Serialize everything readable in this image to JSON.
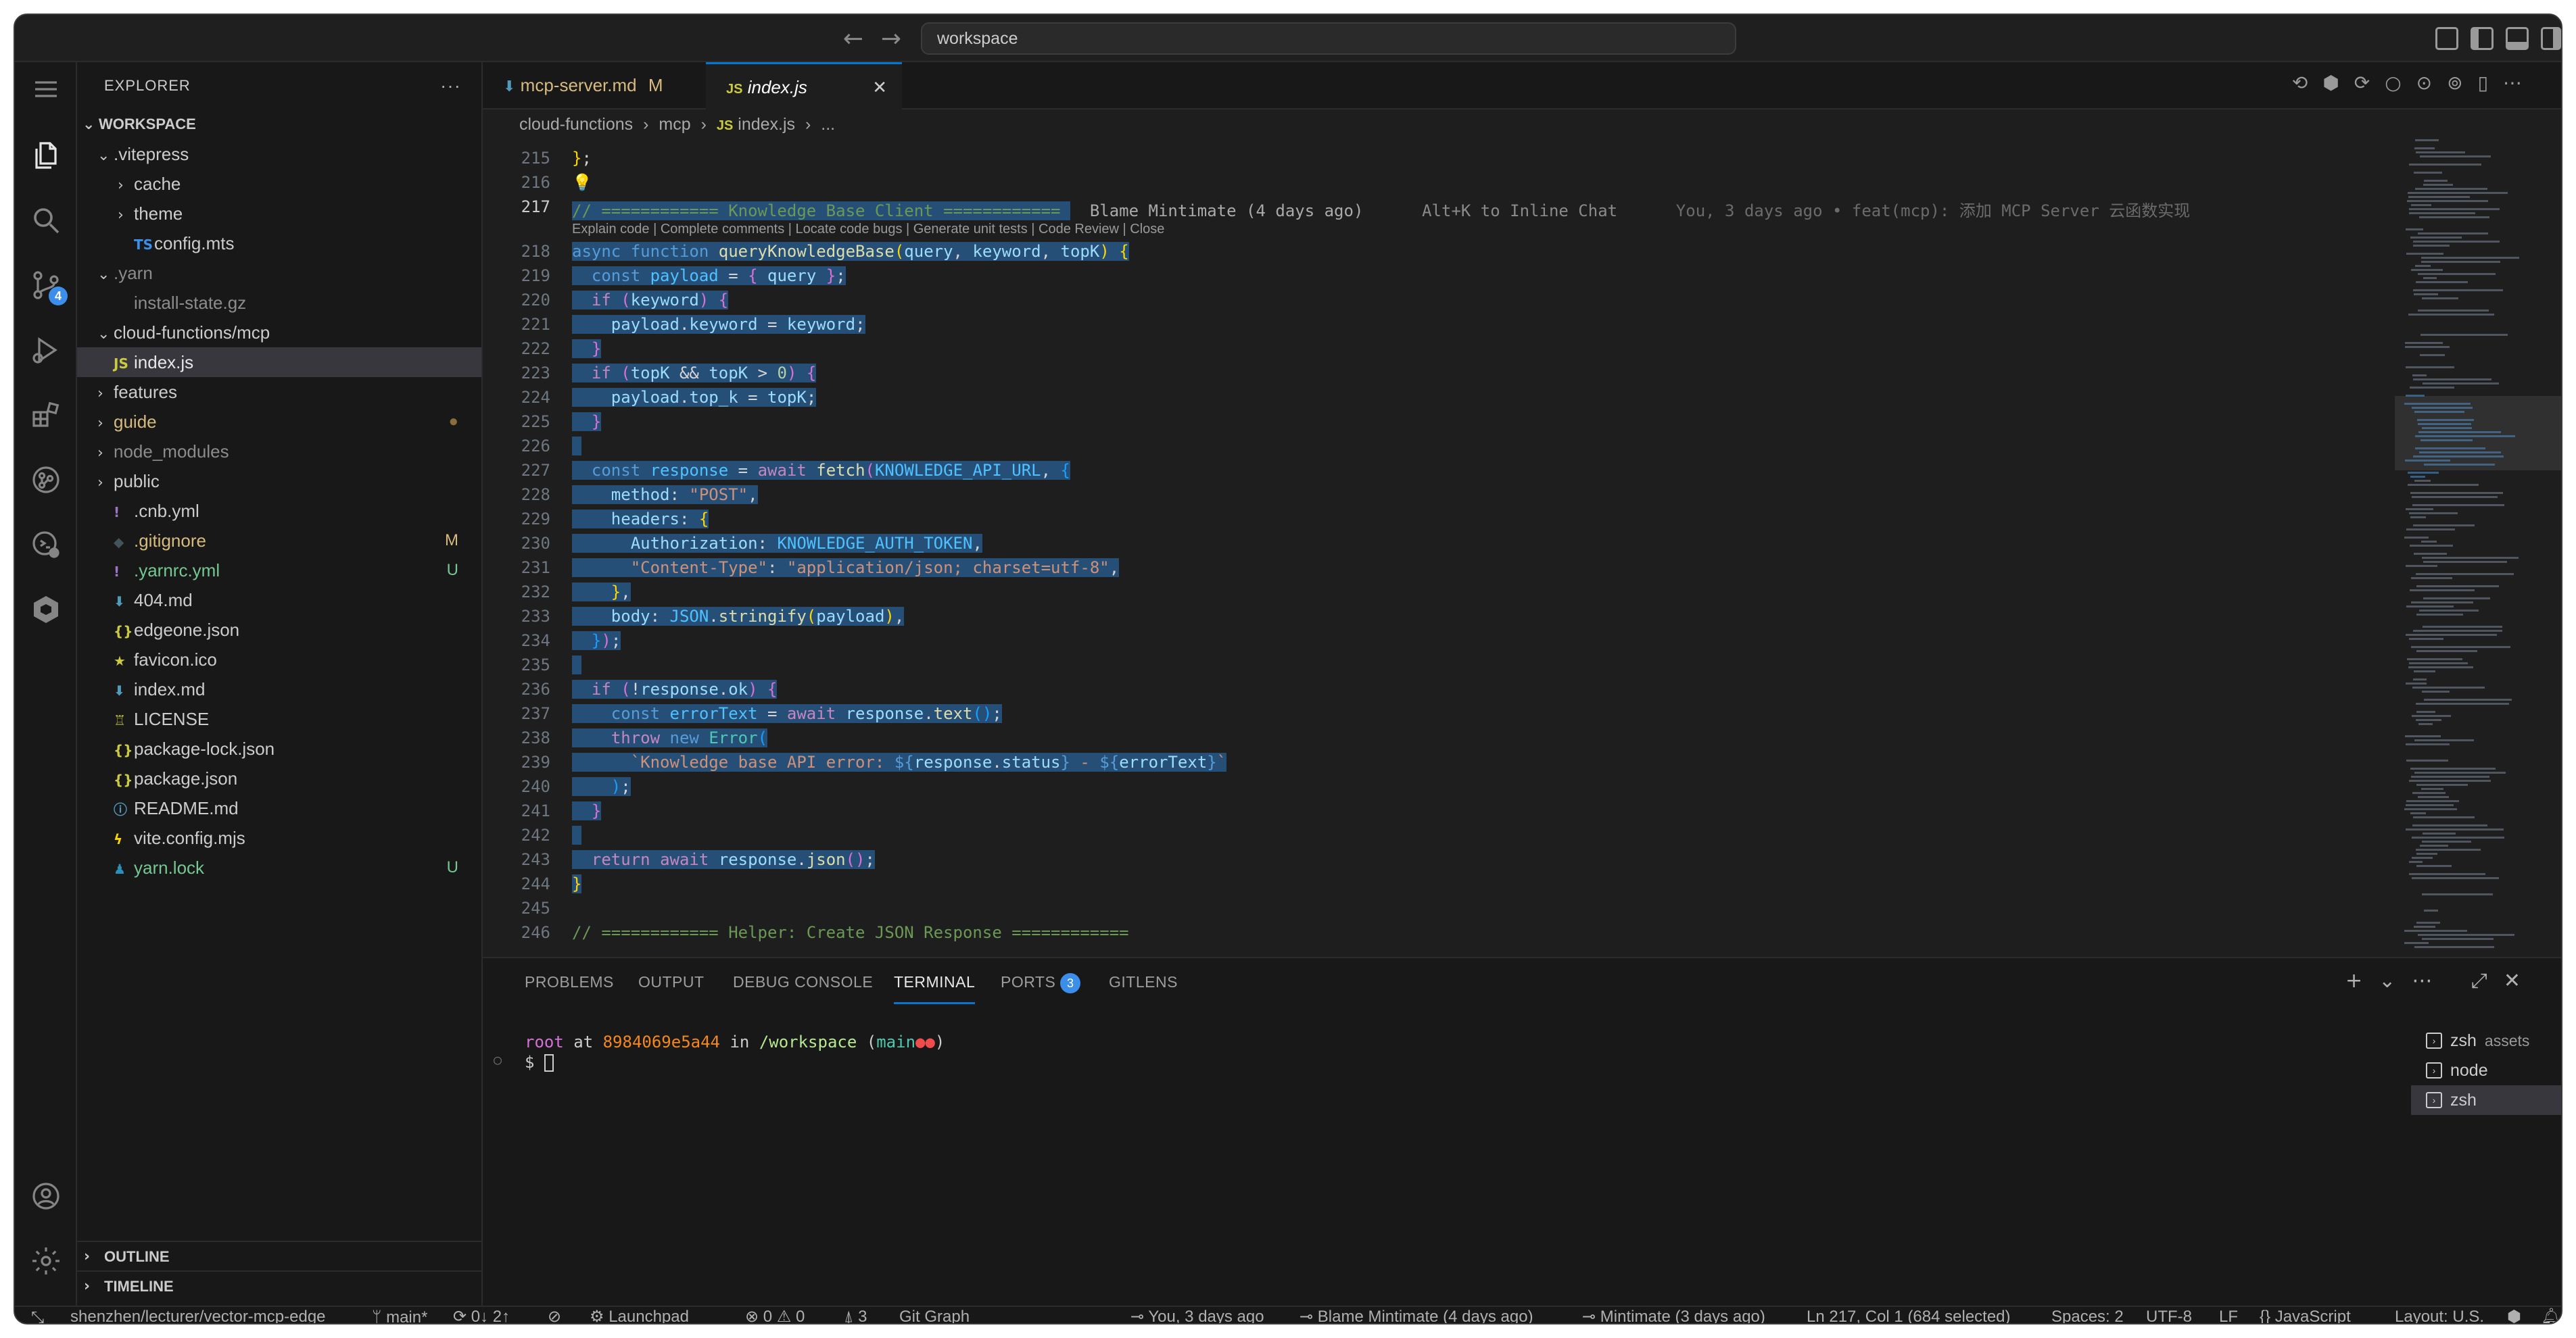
{
  "titlebar": {
    "search": "workspace"
  },
  "activity": {
    "scm_badge": "4"
  },
  "explorer": {
    "title": "EXPLORER",
    "more": "···",
    "workspace": "WORKSPACE",
    "outline": "OUTLINE",
    "timeline": "TIMELINE",
    "tree": [
      {
        "label": ".vitepress",
        "chev": "⌄",
        "indent": 0,
        "color": "#cccccc",
        "icon": ""
      },
      {
        "label": "cache",
        "chev": "›",
        "indent": 1,
        "color": "#cccccc",
        "icon": ""
      },
      {
        "label": "theme",
        "chev": "›",
        "indent": 1,
        "color": "#cccccc",
        "icon": ""
      },
      {
        "label": "config.mts",
        "chev": "",
        "indent": 1,
        "color": "#cccccc",
        "icon": "TS",
        "icon_color": "#3b8eea"
      },
      {
        "label": ".yarn",
        "chev": "⌄",
        "indent": 0,
        "color": "#8c8c8c",
        "icon": ""
      },
      {
        "label": "install-state.gz",
        "chev": "",
        "indent": 1,
        "color": "#8c8c8c",
        "icon": "",
        "icon_color": "#8c8c8c"
      },
      {
        "label": "cloud-functions/mcp",
        "chev": "⌄",
        "indent": 0,
        "color": "#cccccc",
        "icon": ""
      },
      {
        "label": "index.js",
        "chev": "",
        "indent": 0,
        "color": "#e7e7e7",
        "icon": "JS",
        "icon_color": "#cbcb41",
        "selected": true
      },
      {
        "label": "features",
        "chev": "›",
        "indent": 0,
        "color": "#cccccc",
        "icon": ""
      },
      {
        "label": "guide",
        "chev": "›",
        "indent": 0,
        "color": "#d7ba7d",
        "icon": "",
        "status": "●",
        "status_color": "#8a6d3b"
      },
      {
        "label": "node_modules",
        "chev": "›",
        "indent": 0,
        "color": "#8c8c8c",
        "icon": ""
      },
      {
        "label": "public",
        "chev": "›",
        "indent": 0,
        "color": "#cccccc",
        "icon": ""
      },
      {
        "label": ".cnb.yml",
        "chev": "",
        "indent": 0,
        "color": "#cccccc",
        "icon": "!",
        "icon_color": "#a074c4"
      },
      {
        "label": ".gitignore",
        "chev": "",
        "indent": 0,
        "color": "#d7ba7d",
        "icon": "◆",
        "icon_color": "#41535b",
        "status": "M",
        "status_color": "#d7ba7d"
      },
      {
        "label": ".yarnrc.yml",
        "chev": "",
        "indent": 0,
        "color": "#73c991",
        "icon": "!",
        "icon_color": "#a074c4",
        "status": "U",
        "status_color": "#73c991"
      },
      {
        "label": "404.md",
        "chev": "",
        "indent": 0,
        "color": "#cccccc",
        "icon": "⬇",
        "icon_color": "#519aba"
      },
      {
        "label": "edgeone.json",
        "chev": "",
        "indent": 0,
        "color": "#cccccc",
        "icon": "{}",
        "icon_color": "#cbcb41"
      },
      {
        "label": "favicon.ico",
        "chev": "",
        "indent": 0,
        "color": "#cccccc",
        "icon": "★",
        "icon_color": "#cbcb41"
      },
      {
        "label": "index.md",
        "chev": "",
        "indent": 0,
        "color": "#cccccc",
        "icon": "⬇",
        "icon_color": "#519aba"
      },
      {
        "label": "LICENSE",
        "chev": "",
        "indent": 0,
        "color": "#cccccc",
        "icon": "♖",
        "icon_color": "#cbcb41"
      },
      {
        "label": "package-lock.json",
        "chev": "",
        "indent": 0,
        "color": "#cccccc",
        "icon": "{}",
        "icon_color": "#cbcb41"
      },
      {
        "label": "package.json",
        "chev": "",
        "indent": 0,
        "color": "#cccccc",
        "icon": "{}",
        "icon_color": "#cbcb41"
      },
      {
        "label": "README.md",
        "chev": "",
        "indent": 0,
        "color": "#cccccc",
        "icon": "ⓘ",
        "icon_color": "#519aba"
      },
      {
        "label": "vite.config.mjs",
        "chev": "",
        "indent": 0,
        "color": "#cccccc",
        "icon": "ϟ",
        "icon_color": "#ffd700"
      },
      {
        "label": "yarn.lock",
        "chev": "",
        "indent": 0,
        "color": "#73c991",
        "icon": "♟",
        "icon_color": "#2c8ebb",
        "status": "U",
        "status_color": "#73c991"
      }
    ]
  },
  "tabs": [
    {
      "label": "mcp-server.md",
      "status": "M",
      "icon": "⬇",
      "active": false
    },
    {
      "label": "index.js",
      "status": "",
      "icon": "JS",
      "active": true,
      "close": "✕"
    }
  ],
  "breadcrumb": [
    "cloud-functions",
    "mcp",
    "index.js",
    "..."
  ],
  "editor": {
    "codelens": "Explain code | Complete comments | Locate code bugs | Generate unit tests | Code Review | Close",
    "blame_hint": "Blame Mintimate (4 days ago)",
    "inline_chat_hint": "Alt+K to Inline Chat",
    "inline_blame": "You, 3 days ago • feat(mcp): 添加 MCP Server 云函数实现",
    "lines": [
      "215",
      "216",
      "217",
      "218",
      "219",
      "220",
      "221",
      "222",
      "223",
      "224",
      "225",
      "226",
      "227",
      "228",
      "229",
      "230",
      "231",
      "232",
      "233",
      "234",
      "235",
      "236",
      "237",
      "238",
      "239",
      "240",
      "241",
      "242",
      "243",
      "244",
      "245",
      "246"
    ]
  },
  "panel": {
    "tabs": [
      "PROBLEMS",
      "OUTPUT",
      "DEBUG CONSOLE",
      "TERMINAL",
      "PORTS",
      "GITLENS"
    ],
    "ports_badge": "3",
    "terminal": {
      "user": "root",
      "at": "at",
      "host": "8984069e5a44",
      "in": "in",
      "path": "/workspace",
      "branch": "main",
      "prompt": "$"
    },
    "terminals": [
      {
        "label": "zsh",
        "extra": "assets",
        "selected": false
      },
      {
        "label": "node",
        "extra": "",
        "selected": false
      },
      {
        "label": "zsh",
        "extra": "",
        "selected": true
      }
    ]
  },
  "statusbar": {
    "remote": "shenzhen/lecturer/vector-mcp-edge",
    "branch": "main*",
    "sync": "0↓ 2↑",
    "launchpad": "Launchpad",
    "errors": "0",
    "warnings": "0",
    "ports": "3",
    "gitgraph": "Git Graph",
    "blame_you": "You, 3 days ago",
    "blame_min": "Blame Mintimate (4 days ago)",
    "mintimate": "Mintimate (3 days ago)",
    "position": "Ln 217, Col 1 (684 selected)",
    "spaces": "Spaces: 2",
    "encoding": "UTF-8",
    "eol": "LF",
    "language": "JavaScript",
    "layout": "Layout: U.S."
  }
}
